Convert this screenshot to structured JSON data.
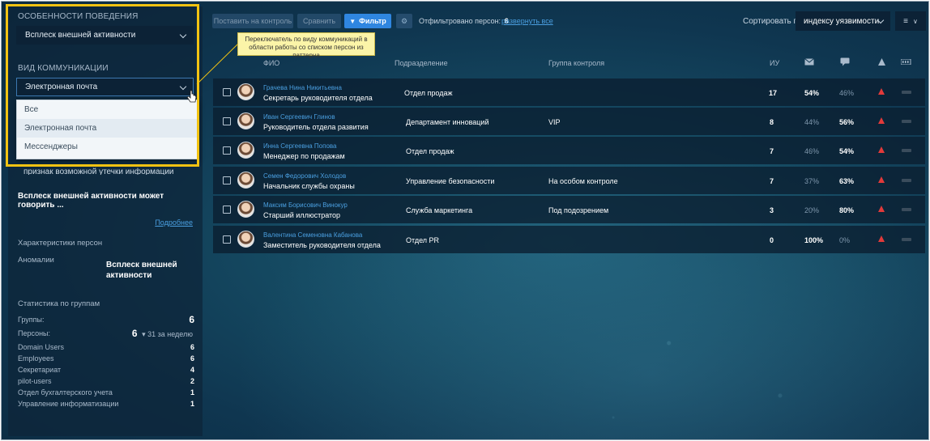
{
  "sidebar": {
    "behavior_label": "ОСОБЕННОСТИ ПОВЕДЕНИЯ",
    "behavior_value": "Всплеск внешней активности",
    "comm_label": "ВИД КОММУНИКАЦИИ",
    "comm_value": "Электронная почта",
    "comm_options": [
      "Все",
      "Электронная почта",
      "Мессенджеры"
    ],
    "partial_text": "признак возможной утечки информации",
    "description": "Всплеск внешней активности может говорить ...",
    "more_link": "Подробнее",
    "characteristics_label": "Характеристики персон",
    "anomalies_label": "Аномалии",
    "anomalies_value": "Всплеск внешней активности",
    "stats_label": "Статистика по группам",
    "groups_label": "Группы:",
    "groups_value": "6",
    "persons_label": "Персоны:",
    "persons_value": "6",
    "persons_week": "31 за неделю",
    "group_stats": [
      {
        "name": "Domain Users",
        "value": "6"
      },
      {
        "name": "Employees",
        "value": "6"
      },
      {
        "name": "Секретариат",
        "value": "4"
      },
      {
        "name": "pilot-users",
        "value": "2"
      },
      {
        "name": "Отдел бухгалтерского учета",
        "value": "1"
      },
      {
        "name": "Управление информатизации",
        "value": "1"
      }
    ]
  },
  "tooltip": "Переключатель по виду коммуникаций в области работы со списком персон из паттерна",
  "toolbar": {
    "control_button": "Поставить на контроль",
    "compare_button": "Сравнить",
    "filter_button": "Фильтр",
    "filtered_label": "Отфильтровано персон:",
    "filtered_count": "6",
    "expand_link": "развернуть все",
    "sort_label": "Сортировать по",
    "sort_value": "индексу уязвимости"
  },
  "table": {
    "headers": {
      "name": "ФИО",
      "department": "Подразделение",
      "control_group": "Группа контроля",
      "index": "ИУ"
    },
    "rows": [
      {
        "name": "Грачева Нина Никитьевна",
        "title": "Секретарь руководителя отдела",
        "department": "Отдел продаж",
        "group": "",
        "iu": "17",
        "mail": "54%",
        "msg": "46%",
        "mail_bold": true
      },
      {
        "name": "Иван Сергеевич Глинов",
        "title": "Руководитель отдела развития",
        "department": "Департамент инноваций",
        "group": "VIP",
        "iu": "8",
        "mail": "44%",
        "msg": "56%",
        "mail_bold": false
      },
      {
        "name": "Инна Сергеевна Попова",
        "title": "Менеджер по продажам",
        "department": "Отдел продаж",
        "group": "",
        "iu": "7",
        "mail": "46%",
        "msg": "54%",
        "mail_bold": false
      },
      {
        "name": "Семен Федорович Холодов",
        "title": "Начальник службы охраны",
        "department": "Управление безопасности",
        "group": "На особом контроле",
        "iu": "7",
        "mail": "37%",
        "msg": "63%",
        "mail_bold": false
      },
      {
        "name": "Максим Борисович Винокур",
        "title": "Старший иллюстратор",
        "department": "Служба маркетинга",
        "group": "Под подозрением",
        "iu": "3",
        "mail": "20%",
        "msg": "80%",
        "mail_bold": false
      },
      {
        "name": "Валентина Семеновна Кабанова",
        "title": "Заместитель руководителя отдела",
        "department": "Отдел PR",
        "group": "",
        "iu": "0",
        "mail": "100%",
        "msg": "0%",
        "mail_bold": true
      }
    ]
  },
  "colors": {
    "accent": "#2f86e0",
    "link": "#4a9fe0",
    "highlight": "#f2c312",
    "warning": "#e23a3a",
    "tooltip_bg": "#fbf4a8"
  }
}
